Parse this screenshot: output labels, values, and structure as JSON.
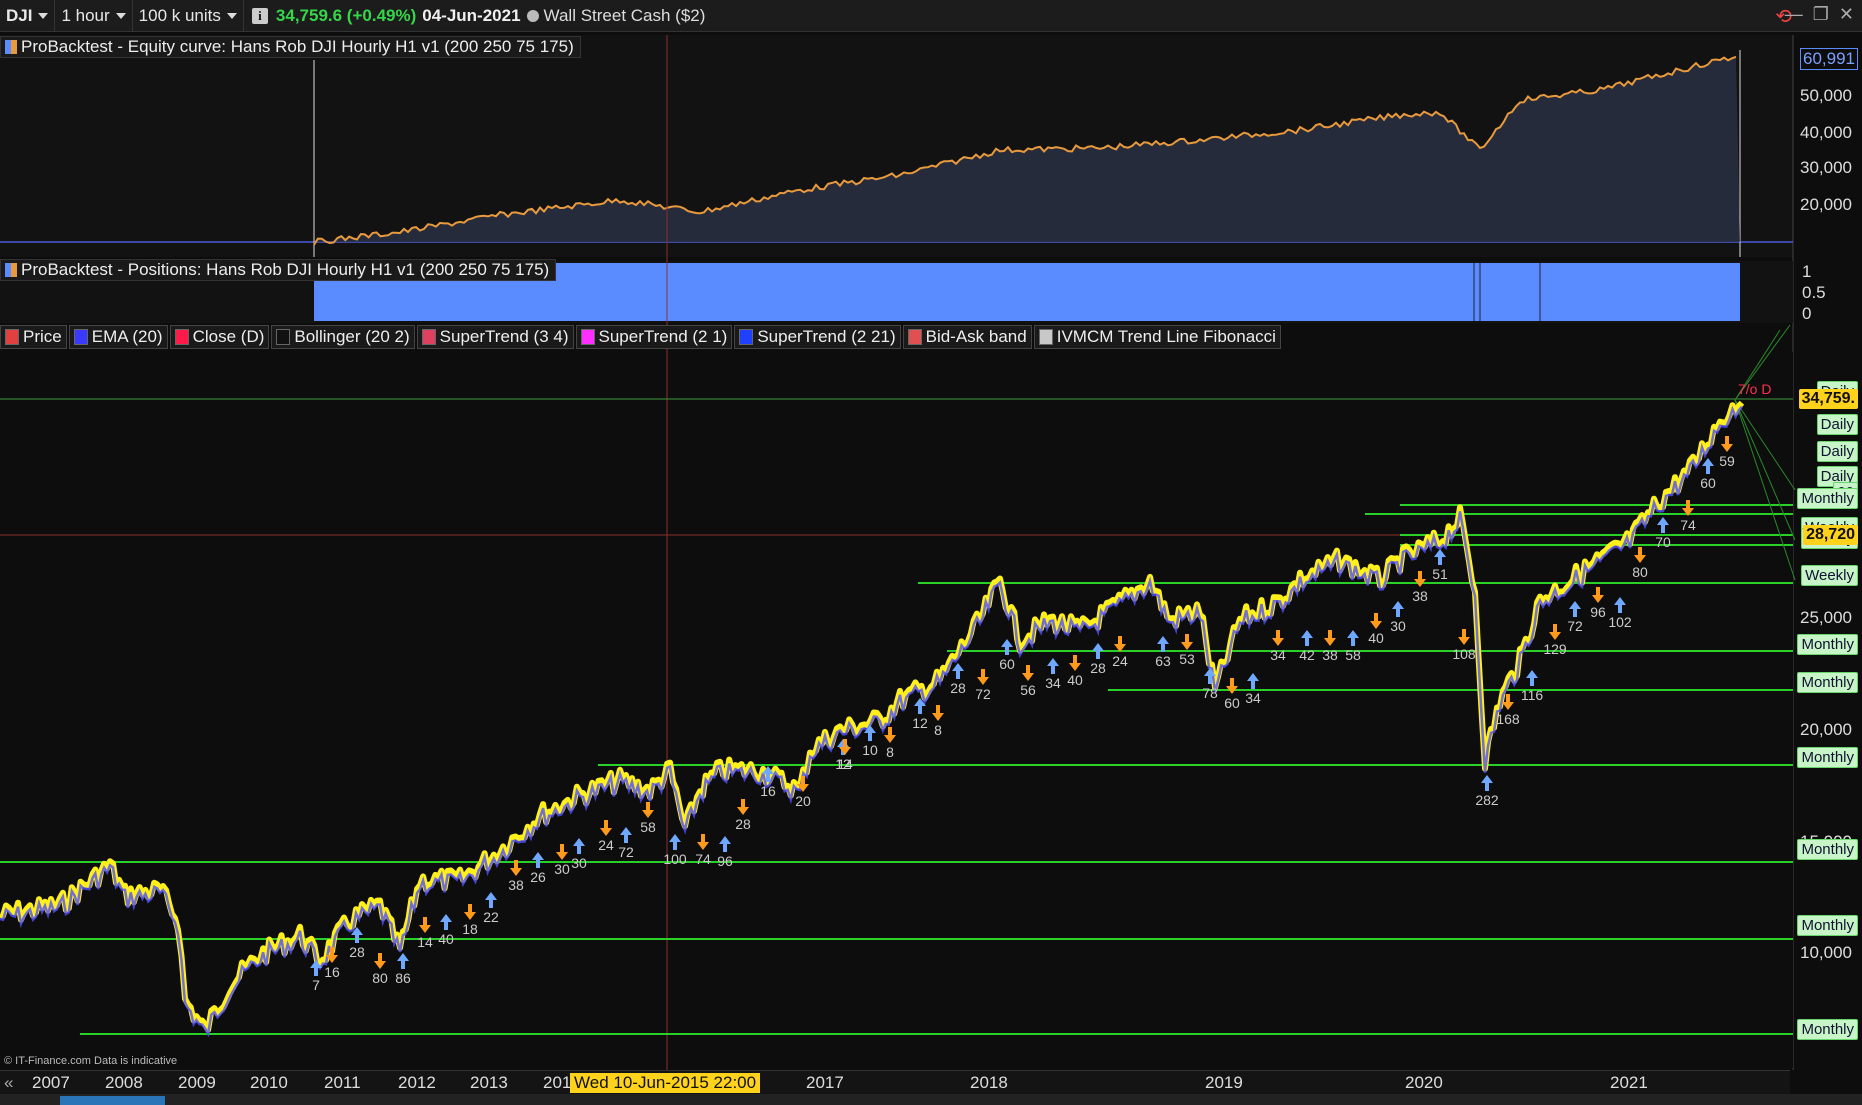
{
  "toolbar": {
    "symbol": "DJI",
    "timeframe": "1 hour",
    "units": "100 k units",
    "price": "34,759.6 (+0.49%)",
    "date": "04-Jun-2021",
    "instrument": "Wall Street Cash ($2)"
  },
  "equity_panel": {
    "label": "ProBacktest - Equity curve: Hans Rob DJI Hourly H1 v1 (200 250 75 175)",
    "last_value": "60,991",
    "ticks": [
      "50,000",
      "40,000",
      "30,000",
      "20,000"
    ]
  },
  "positions_panel": {
    "label": "ProBacktest - Positions: Hans Rob DJI Hourly H1 v1 (200 250 75 175)",
    "ticks": [
      "1",
      "0.5",
      "0"
    ]
  },
  "legend": [
    {
      "label": "Price",
      "color": "#e04040"
    },
    {
      "label": "EMA (20)",
      "color": "#3a3aff"
    },
    {
      "label": "Close (D)",
      "color": "#ff1a4a"
    },
    {
      "label": "Bollinger (20 2)",
      "color": "#111111"
    },
    {
      "label": "SuperTrend (3 4)",
      "color": "#e04060"
    },
    {
      "label": "SuperTrend (2 1)",
      "color": "#ff30ff"
    },
    {
      "label": "SuperTrend (2 21)",
      "color": "#2040ff"
    },
    {
      "label": "Bid-Ask band",
      "color": "#e05050"
    },
    {
      "label": "IVMCM Trend Line Fibonacci",
      "color": "#c8c8c8"
    }
  ],
  "price_axis": {
    "ticks": [
      "25,000",
      "20,000",
      "15,000",
      "10,000"
    ],
    "current_price": "34,759.",
    "level_price": "28,720",
    "stray_labels": [
      "Daily",
      "Daily",
      "Daily",
      "Daily",
      "00",
      "Monthly",
      "Weekly",
      "Weekly",
      "Weekly",
      "Monthly",
      "Monthly",
      "Monthly",
      "Monthly",
      "Monthly",
      "Monthly"
    ],
    "overlay_text": "7/o D"
  },
  "trade_labels": [
    "7",
    "16",
    "28",
    "80",
    "86",
    "14",
    "40",
    "18",
    "22",
    "38",
    "26",
    "30",
    "30",
    "24",
    "72",
    "58",
    "100",
    "74",
    "96",
    "28",
    "16",
    "20",
    "12",
    "14",
    "10",
    "8",
    "12",
    "8",
    "28",
    "72",
    "60",
    "56",
    "34",
    "40",
    "28",
    "24",
    "63",
    "53",
    "78",
    "60",
    "34",
    "34",
    "42",
    "38",
    "58",
    "40",
    "30",
    "38",
    "51",
    "108",
    "282",
    "168",
    "116",
    "129",
    "72",
    "96",
    "102",
    "80",
    "70",
    "74",
    "60",
    "59"
  ],
  "time_axis": {
    "years": [
      "2007",
      "2008",
      "2009",
      "2010",
      "2011",
      "2012",
      "2013",
      "201",
      "2017",
      "2018",
      "2019",
      "2020",
      "2021"
    ],
    "cursor": "Wed 10-Jun-2015 22:00"
  },
  "credit": "© IT-Finance.com  Data is indicative",
  "colors": {
    "price_up": "#ffef1a",
    "equity_line": "#e89a3c",
    "positions_fill": "#5b8cff",
    "level_line": "#28d028",
    "buy_arrow": "#6fa8ff",
    "sell_arrow": "#ff9a1a"
  }
}
